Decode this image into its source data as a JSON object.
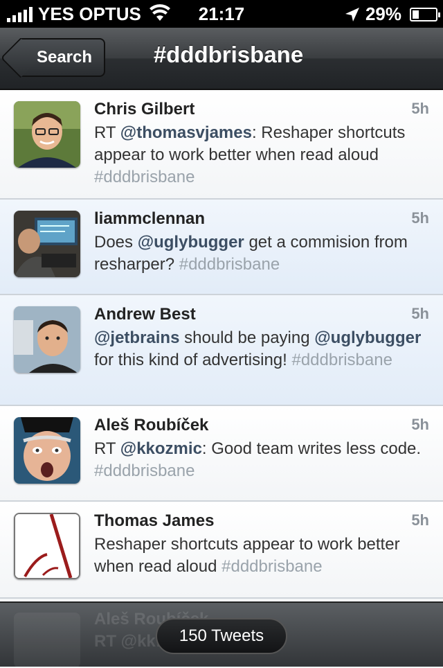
{
  "status_bar": {
    "carrier": "YES OPTUS",
    "time": "21:17",
    "battery": "29%",
    "battery_fraction": 0.29
  },
  "nav": {
    "back_label": "Search",
    "title": "#dddbrisbane"
  },
  "tweets": [
    {
      "name": "Chris Gilbert",
      "time": "5h",
      "highlight": false,
      "parts": [
        [
          "text",
          "RT "
        ],
        [
          "mention",
          "@thomasvjames"
        ],
        [
          "text",
          ": Reshaper shortcuts appear to work better when read aloud "
        ],
        [
          "hashtag",
          "#dddbrisbane"
        ]
      ]
    },
    {
      "name": "liammclennan",
      "time": "5h",
      "highlight": true,
      "parts": [
        [
          "text",
          "Does "
        ],
        [
          "mention",
          "@uglybugger"
        ],
        [
          "text",
          " get a commision from resharper? "
        ],
        [
          "hashtag",
          "#dddbrisbane"
        ]
      ]
    },
    {
      "name": "Andrew Best",
      "time": "5h",
      "highlight": true,
      "parts": [
        [
          "mention",
          "@jetbrains"
        ],
        [
          "text",
          " should be paying "
        ],
        [
          "mention",
          "@uglybugger"
        ],
        [
          "text",
          "  for this kind of advertising! "
        ],
        [
          "hashtag",
          "#dddbrisbane"
        ]
      ]
    },
    {
      "name": "Aleš Roubíček",
      "time": "5h",
      "highlight": false,
      "parts": [
        [
          "text",
          "RT "
        ],
        [
          "mention",
          "@kkozmic"
        ],
        [
          "text",
          ": Good team writes less code. "
        ],
        [
          "hashtag",
          "#dddbrisbane"
        ]
      ]
    },
    {
      "name": "Thomas James",
      "time": "5h",
      "highlight": false,
      "parts": [
        [
          "text",
          "Reshaper shortcuts appear to work better when read aloud "
        ],
        [
          "hashtag",
          "#dddbrisbane"
        ]
      ]
    }
  ],
  "peek": {
    "name": "Aleš Roubíček",
    "line": "RT @kk… vs them\" on"
  },
  "bottom": {
    "tweet_count": "150 Tweets"
  }
}
